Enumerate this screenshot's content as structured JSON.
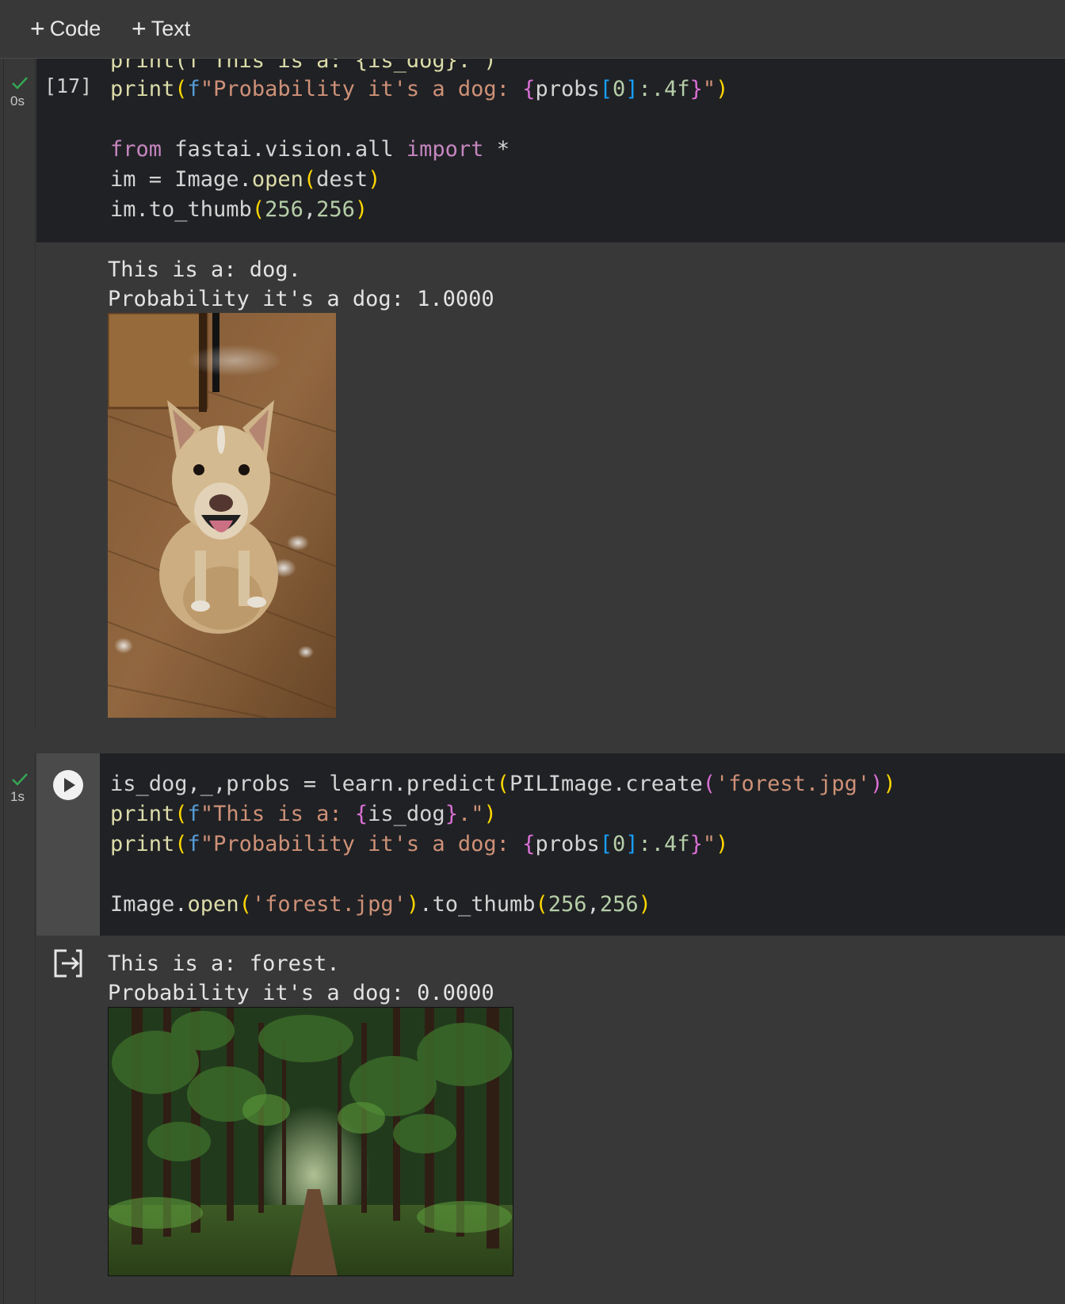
{
  "toolbar": {
    "add_code_label": "Code",
    "add_text_label": "Text",
    "plus_glyph": "+"
  },
  "cell1": {
    "status_icon": "check-icon",
    "status_color": "#34a853",
    "exec_time": "0s",
    "exec_count": "[17]",
    "code_partial_line": "print(f\"This is a: {is_dog}.\")",
    "code_lines": {
      "l1_fn": "print",
      "l1_rest_open": "(",
      "l1_prefix": "f",
      "l1_str": "\"Probability it's a dog: ",
      "l1_brace_open": "{",
      "l1_var": "probs",
      "l1_idx_open": "[",
      "l1_idx": "0",
      "l1_idx_close": "]",
      "l1_fmt": ":.4f",
      "l1_brace_close": "}",
      "l1_str_end": "\"",
      "l1_close": ")",
      "l2_from": "from",
      "l2_mod": " fastai.vision.all ",
      "l2_import": "import",
      "l2_star": " *",
      "l3_a": "im = Image.",
      "l3_fn": "open",
      "l3_open": "(",
      "l3_arg": "dest",
      "l3_close": ")",
      "l4_a": "im.to_thumb",
      "l4_open": "(",
      "l4_n1": "256",
      "l4_comma": ",",
      "l4_n2": "256",
      "l4_close": ")"
    },
    "output_lines": [
      "This is a: dog.",
      "Probability it's a dog: 1.0000"
    ],
    "image_subject": "dog photo"
  },
  "cell2": {
    "status_icon": "check-icon",
    "status_color": "#34a853",
    "exec_time": "1s",
    "run_icon": "play-icon",
    "output_icon": "output-redirect-icon",
    "code_lines": {
      "l1_a": "is_dog,_,probs = learn.predict",
      "l1_open": "(",
      "l1_b": "PILImage.create",
      "l1_open2": "(",
      "l1_str": "'forest.jpg'",
      "l1_close2": ")",
      "l1_close": ")",
      "l2_fn": "print",
      "l2_open": "(",
      "l2_prefix": "f",
      "l2_str": "\"This is a: ",
      "l2_brace_open": "{",
      "l2_var": "is_dog",
      "l2_brace_close": "}",
      "l2_str_end": ".\"",
      "l2_close": ")",
      "l3_fn": "print",
      "l3_open": "(",
      "l3_prefix": "f",
      "l3_str": "\"Probability it's a dog: ",
      "l3_brace_open": "{",
      "l3_var": "probs",
      "l3_idx_open": "[",
      "l3_idx": "0",
      "l3_idx_close": "]",
      "l3_fmt": ":.4f",
      "l3_brace_close": "}",
      "l3_str_end": "\"",
      "l3_close": ")",
      "l4_a": "Image.",
      "l4_fn": "open",
      "l4_open": "(",
      "l4_str": "'forest.jpg'",
      "l4_close": ")",
      "l4_b": ".to_thumb",
      "l4_open2": "(",
      "l4_n1": "256",
      "l4_comma": ",",
      "l4_n2": "256",
      "l4_close2": ")"
    },
    "output_lines": [
      "This is a: forest.",
      "Probability it's a dog: 0.0000"
    ],
    "image_subject": "forest photo"
  }
}
